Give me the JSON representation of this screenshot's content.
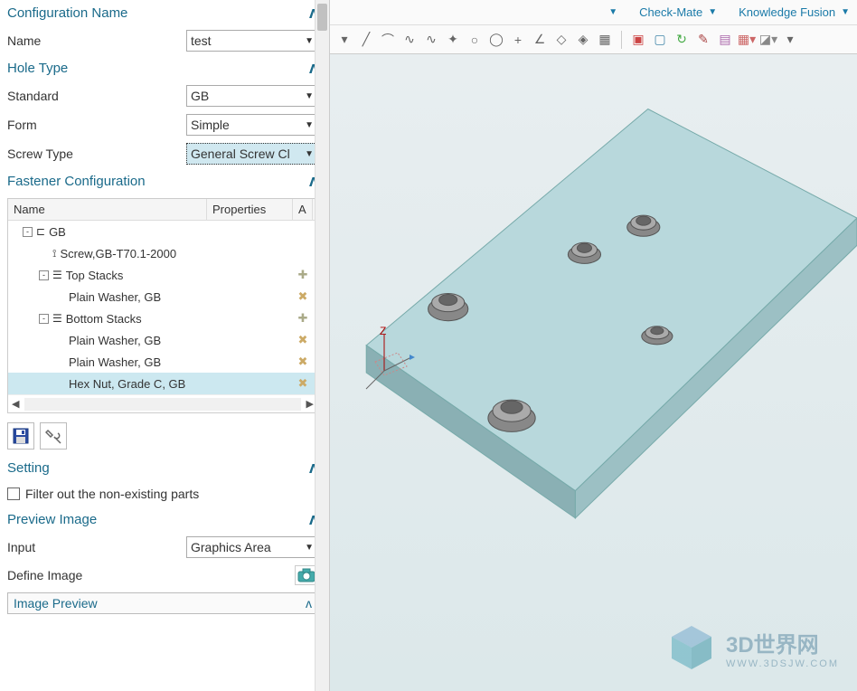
{
  "sections": {
    "config_name": {
      "title": "Configuration Name",
      "fields": {
        "name_label": "Name",
        "name_value": "test"
      }
    },
    "hole_type": {
      "title": "Hole Type",
      "fields": {
        "standard_label": "Standard",
        "standard_value": "GB",
        "form_label": "Form",
        "form_value": "Simple",
        "screw_type_label": "Screw Type",
        "screw_type_value": "General Screw Cl"
      }
    },
    "fastener_config": {
      "title": "Fastener Configuration",
      "columns": {
        "name": "Name",
        "properties": "Properties",
        "a": "A"
      },
      "tree": [
        {
          "indent": 0,
          "toggle": "-",
          "icon": "bracket",
          "label": "GB"
        },
        {
          "indent": 1,
          "toggle": "",
          "icon": "screw",
          "label": "Screw,GB-T70.1-2000"
        },
        {
          "indent": 1,
          "toggle": "-",
          "icon": "stack",
          "label": "Top Stacks",
          "a": "add"
        },
        {
          "indent": 2,
          "toggle": "",
          "icon": "",
          "label": "Plain Washer, GB",
          "a": "tool"
        },
        {
          "indent": 1,
          "toggle": "-",
          "icon": "stack",
          "label": "Bottom Stacks",
          "a": "add"
        },
        {
          "indent": 2,
          "toggle": "",
          "icon": "",
          "label": "Plain Washer, GB",
          "a": "tool"
        },
        {
          "indent": 2,
          "toggle": "",
          "icon": "",
          "label": "Plain Washer, GB",
          "a": "tool"
        },
        {
          "indent": 2,
          "toggle": "",
          "icon": "",
          "label": "Hex Nut, Grade C, GB",
          "a": "tool",
          "selected": true
        }
      ]
    },
    "setting": {
      "title": "Setting",
      "filter_label": "Filter out the non-existing parts"
    },
    "preview_image": {
      "title": "Preview Image",
      "input_label": "Input",
      "input_value": "Graphics Area",
      "define_label": "Define Image",
      "subsection": "Image Preview"
    }
  },
  "top_menu": {
    "check_mate": "Check-Mate",
    "knowledge_fusion": "Knowledge Fusion"
  },
  "watermark": {
    "main": "3D世界网",
    "sub": "WWW.3DSJW.COM"
  },
  "axis": {
    "z": "Z"
  }
}
